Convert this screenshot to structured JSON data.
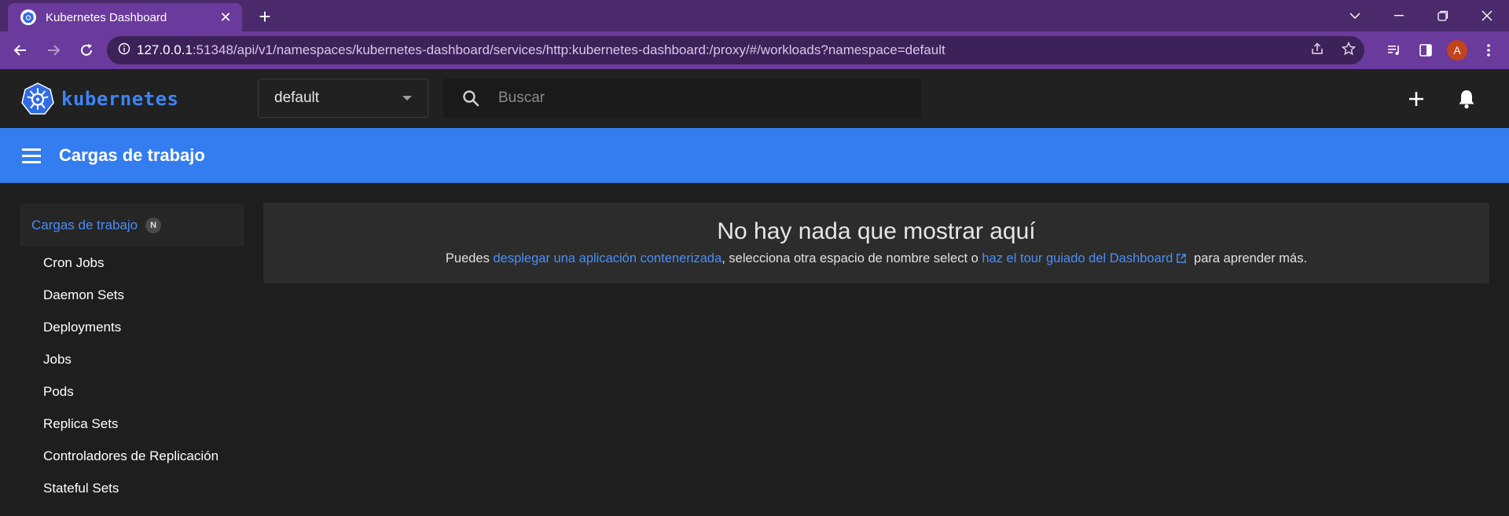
{
  "browser": {
    "tab_title": "Kubernetes Dashboard",
    "url_host": "127.0.0.1",
    "url_rest": ":51348/api/v1/namespaces/kubernetes-dashboard/services/http:kubernetes-dashboard:/proxy/#/workloads?namespace=default",
    "profile_initial": "A",
    "accent_color": "#6a3a9c"
  },
  "header": {
    "logo_text": "kubernetes",
    "namespace_value": "default",
    "search_placeholder": "Buscar"
  },
  "titlebar": {
    "title": "Cargas de trabajo",
    "color": "#347df0"
  },
  "sidebar": {
    "header_label": "Cargas de trabajo",
    "header_badge": "N",
    "items": [
      {
        "label": "Cron Jobs"
      },
      {
        "label": "Daemon Sets"
      },
      {
        "label": "Deployments"
      },
      {
        "label": "Jobs"
      },
      {
        "label": "Pods"
      },
      {
        "label": "Replica Sets"
      },
      {
        "label": "Controladores de Replicación"
      },
      {
        "label": "Stateful Sets"
      }
    ]
  },
  "empty_state": {
    "title": "No hay nada que mostrar aquí",
    "text_prefix": "Puedes ",
    "link_deploy": "desplegar una aplicación contenerizada",
    "text_middle": ", selecciona otra espacio de nombre select o ",
    "link_tour": "haz el tour guiado del Dashboard",
    "text_suffix": " para aprender más."
  }
}
